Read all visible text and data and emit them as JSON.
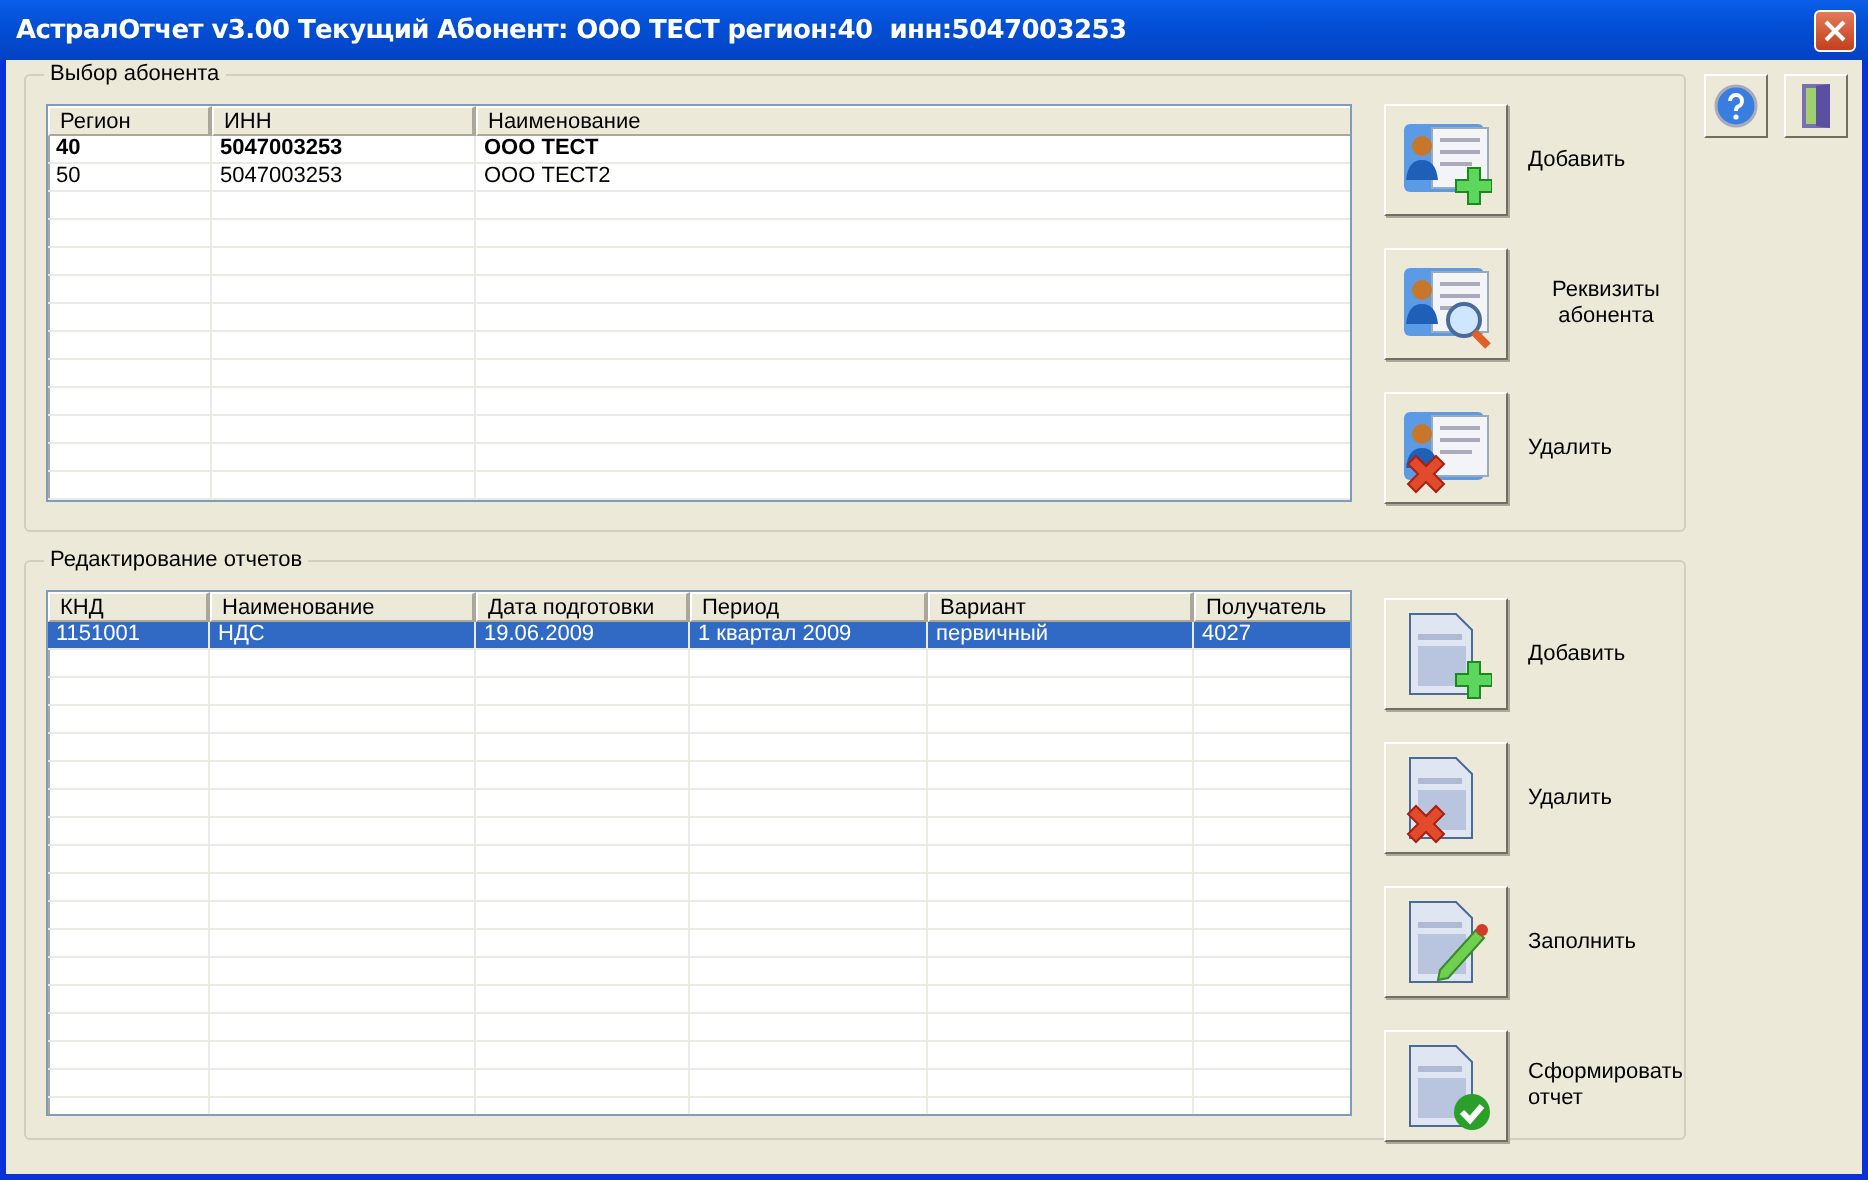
{
  "window": {
    "title": "АстралОтчет v3.00 Текущий Абонент: ООО ТЕСТ регион:40  инн:5047003253"
  },
  "subscribers": {
    "title": "Выбор абонента",
    "columns": [
      "Регион",
      "ИНН",
      "Наименование"
    ],
    "rows": [
      {
        "cells": [
          "40",
          "5047003253",
          "ООО ТЕСТ"
        ],
        "current": true
      },
      {
        "cells": [
          "50",
          "5047003253",
          "ООО ТЕСТ2"
        ],
        "current": false
      }
    ],
    "buttons": [
      {
        "kind": "add-person",
        "label": "Добавить"
      },
      {
        "kind": "view-person",
        "label": "Реквизиты абонента"
      },
      {
        "kind": "delete-person",
        "label": "Удалить"
      }
    ]
  },
  "reports": {
    "title": "Редактирование отчетов",
    "columns": [
      "КНД",
      "Наименование",
      "Дата подготовки",
      "Период",
      "Вариант",
      "Получатель"
    ],
    "rows": [
      {
        "cells": [
          "1151001",
          "НДС",
          "19.06.2009",
          "1 квартал 2009",
          "первичный",
          "4027"
        ],
        "selected": true
      }
    ],
    "buttons": [
      {
        "kind": "add-doc",
        "label": "Добавить"
      },
      {
        "kind": "delete-doc",
        "label": "Удалить"
      },
      {
        "kind": "edit-doc",
        "label": "Заполнить"
      },
      {
        "kind": "check-doc",
        "label": "Сформировать отчет"
      }
    ]
  },
  "tools": [
    {
      "kind": "help"
    },
    {
      "kind": "exit"
    }
  ]
}
